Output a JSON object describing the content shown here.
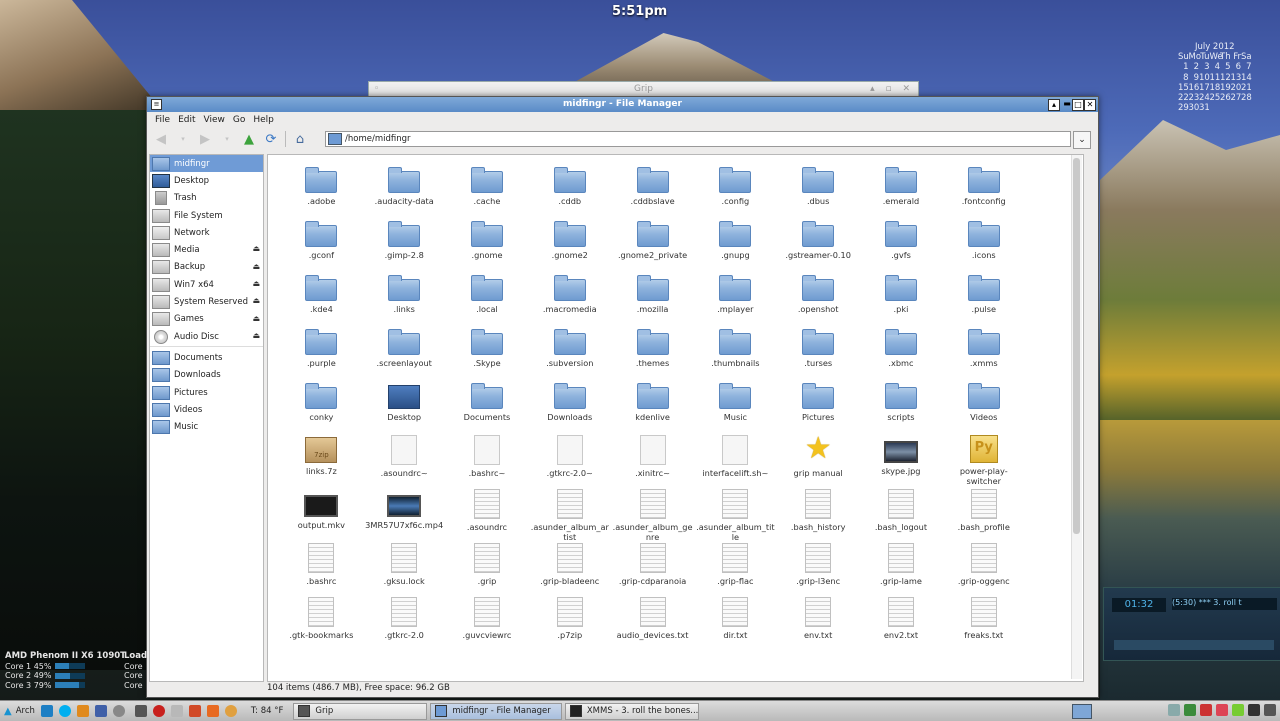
{
  "clock": "5:51pm",
  "calendar": {
    "month": "July 2012",
    "weekdays": [
      "Su",
      "Mo",
      "Tu",
      "We",
      "Th",
      "Fr",
      "Sa"
    ],
    "weeks": [
      [
        "1",
        "2",
        "3",
        "4",
        "5",
        "6",
        "7"
      ],
      [
        "8",
        "9",
        "10",
        "11",
        "12",
        "13",
        "14"
      ],
      [
        "15",
        "16",
        "17",
        "18",
        "19",
        "20",
        "21"
      ],
      [
        "22",
        "23",
        "24",
        "25",
        "26",
        "27",
        "28"
      ],
      [
        "29",
        "30",
        "31",
        "",
        "",
        "",
        ""
      ]
    ]
  },
  "grip_window": {
    "title": "Grip"
  },
  "file_manager": {
    "title": "midfingr - File Manager",
    "menu": [
      "File",
      "Edit",
      "View",
      "Go",
      "Help"
    ],
    "path": "/home/midfingr",
    "status": "104 items (486.7 MB), Free space: 96.2 GB",
    "sidebar": [
      {
        "label": "midfingr",
        "icon": "home-folder-icon",
        "selected": true
      },
      {
        "label": "Desktop",
        "icon": "desktop-icon"
      },
      {
        "label": "Trash",
        "icon": "trash-icon"
      },
      {
        "label": "File System",
        "icon": "drive-icon"
      },
      {
        "label": "Network",
        "icon": "network-icon"
      },
      {
        "label": "Media",
        "icon": "drive-icon",
        "eject": true
      },
      {
        "label": "Backup",
        "icon": "drive-icon",
        "eject": true
      },
      {
        "label": "Win7 x64",
        "icon": "drive-icon",
        "eject": true
      },
      {
        "label": "System Reserved",
        "icon": "drive-icon",
        "eject": true
      },
      {
        "label": "Games",
        "icon": "drive-icon",
        "eject": true
      },
      {
        "label": "Audio Disc",
        "icon": "disc-icon",
        "eject": true
      },
      {
        "label": "Documents",
        "icon": "folder-icon"
      },
      {
        "label": "Downloads",
        "icon": "folder-icon"
      },
      {
        "label": "Pictures",
        "icon": "folder-icon"
      },
      {
        "label": "Videos",
        "icon": "folder-icon"
      },
      {
        "label": "Music",
        "icon": "folder-icon"
      }
    ],
    "files": [
      {
        "name": ".adobe",
        "type": "folder"
      },
      {
        "name": ".audacity-data",
        "type": "folder"
      },
      {
        "name": ".cache",
        "type": "folder"
      },
      {
        "name": ".cddb",
        "type": "folder"
      },
      {
        "name": ".cddbslave",
        "type": "folder"
      },
      {
        "name": ".config",
        "type": "folder"
      },
      {
        "name": ".dbus",
        "type": "folder"
      },
      {
        "name": ".emerald",
        "type": "folder"
      },
      {
        "name": ".fontconfig",
        "type": "folder"
      },
      {
        "name": ".gconf",
        "type": "folder"
      },
      {
        "name": ".gimp-2.8",
        "type": "folder"
      },
      {
        "name": ".gnome",
        "type": "folder"
      },
      {
        "name": ".gnome2",
        "type": "folder"
      },
      {
        "name": ".gnome2_private",
        "type": "folder"
      },
      {
        "name": ".gnupg",
        "type": "folder"
      },
      {
        "name": ".gstreamer-0.10",
        "type": "folder"
      },
      {
        "name": ".gvfs",
        "type": "folder"
      },
      {
        "name": ".icons",
        "type": "folder"
      },
      {
        "name": ".kde4",
        "type": "folder"
      },
      {
        "name": ".links",
        "type": "folder"
      },
      {
        "name": ".local",
        "type": "folder"
      },
      {
        "name": ".macromedia",
        "type": "folder"
      },
      {
        "name": ".mozilla",
        "type": "folder"
      },
      {
        "name": ".mplayer",
        "type": "folder"
      },
      {
        "name": ".openshot",
        "type": "folder"
      },
      {
        "name": ".pki",
        "type": "folder"
      },
      {
        "name": ".pulse",
        "type": "folder"
      },
      {
        "name": ".purple",
        "type": "folder"
      },
      {
        "name": ".screenlayout",
        "type": "folder"
      },
      {
        "name": ".Skype",
        "type": "folder"
      },
      {
        "name": ".subversion",
        "type": "folder"
      },
      {
        "name": ".themes",
        "type": "folder"
      },
      {
        "name": ".thumbnails",
        "type": "folder"
      },
      {
        "name": ".turses",
        "type": "folder"
      },
      {
        "name": ".xbmc",
        "type": "folder"
      },
      {
        "name": ".xmms",
        "type": "folder"
      },
      {
        "name": "conky",
        "type": "folder"
      },
      {
        "name": "Desktop",
        "type": "deskfolder"
      },
      {
        "name": "Documents",
        "type": "folder"
      },
      {
        "name": "Downloads",
        "type": "folder"
      },
      {
        "name": "kdenlive",
        "type": "folder"
      },
      {
        "name": "Music",
        "type": "folder"
      },
      {
        "name": "Pictures",
        "type": "folder"
      },
      {
        "name": "scripts",
        "type": "folder"
      },
      {
        "name": "Videos",
        "type": "folder"
      },
      {
        "name": "links.7z",
        "type": "zip"
      },
      {
        "name": ".asoundrc~",
        "type": "doc"
      },
      {
        "name": ".bashrc~",
        "type": "doc"
      },
      {
        "name": ".gtkrc-2.0~",
        "type": "doc"
      },
      {
        "name": ".xinitrc~",
        "type": "doc"
      },
      {
        "name": "interfacelift.sh~",
        "type": "doc"
      },
      {
        "name": "grip manual",
        "type": "star"
      },
      {
        "name": "skype.jpg",
        "type": "img"
      },
      {
        "name": "power-play-switcher",
        "type": "py"
      },
      {
        "name": "output.mkv",
        "type": "video"
      },
      {
        "name": "3MR57U7xf6c.mp4",
        "type": "video2"
      },
      {
        "name": ".asoundrc",
        "type": "txt"
      },
      {
        "name": ".asunder_album_artist",
        "type": "txt"
      },
      {
        "name": ".asunder_album_genre",
        "type": "txt"
      },
      {
        "name": ".asunder_album_title",
        "type": "txt"
      },
      {
        "name": ".bash_history",
        "type": "txt"
      },
      {
        "name": ".bash_logout",
        "type": "txt"
      },
      {
        "name": ".bash_profile",
        "type": "txt"
      },
      {
        "name": ".bashrc",
        "type": "txt"
      },
      {
        "name": ".gksu.lock",
        "type": "txt"
      },
      {
        "name": ".grip",
        "type": "txt"
      },
      {
        "name": ".grip-bladeenc",
        "type": "txt"
      },
      {
        "name": ".grip-cdparanoia",
        "type": "txt"
      },
      {
        "name": ".grip-flac",
        "type": "txt"
      },
      {
        "name": ".grip-l3enc",
        "type": "txt"
      },
      {
        "name": ".grip-lame",
        "type": "txt"
      },
      {
        "name": ".grip-oggenc",
        "type": "txt"
      },
      {
        "name": ".gtk-bookmarks",
        "type": "txt"
      },
      {
        "name": ".gtkrc-2.0",
        "type": "txt"
      },
      {
        "name": ".guvcviewrc",
        "type": "txt"
      },
      {
        "name": ".p7zip",
        "type": "txt"
      },
      {
        "name": "audio_devices.txt",
        "type": "txt"
      },
      {
        "name": "dir.txt",
        "type": "txt"
      },
      {
        "name": "env.txt",
        "type": "txt"
      },
      {
        "name": "env2.txt",
        "type": "txt"
      },
      {
        "name": "freaks.txt",
        "type": "txt"
      }
    ]
  },
  "conky": {
    "cpu_name": "AMD Phenom II X6 1090T",
    "load_label": "Load",
    "cores": [
      {
        "label": "Core 1",
        "value": "45%",
        "fill": 0.45
      },
      {
        "label": "Core 2",
        "value": "49%",
        "fill": 0.49
      },
      {
        "label": "Core 3",
        "value": "79%",
        "fill": 0.79
      }
    ],
    "core_short": [
      "Core",
      "Core",
      "Core"
    ]
  },
  "xmms": {
    "time": "01:32",
    "track": "(5:30)  ***  3. roll t"
  },
  "taskbar": {
    "start_label": "Arch",
    "temperature": "T: 84 °F",
    "tasks": [
      {
        "label": "Grip",
        "active": false
      },
      {
        "label": "midfingr - File Manager",
        "active": true
      },
      {
        "label": "XMMS - 3. roll the bones...",
        "active": false
      }
    ]
  }
}
